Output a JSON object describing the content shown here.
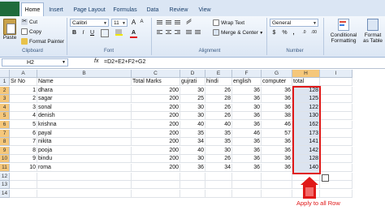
{
  "ribbon": {
    "tabs": [
      "Home",
      "Insert",
      "Page Layout",
      "Formulas",
      "Data",
      "Review",
      "View"
    ],
    "clipboard": {
      "paste": "Paste",
      "cut": "Cut",
      "copy": "Copy",
      "format_painter": "Format Painter",
      "label": "Clipboard"
    },
    "font": {
      "family": "Calibri",
      "size": "11",
      "bold": "B",
      "italic": "I",
      "underline": "U",
      "label": "Font"
    },
    "alignment": {
      "wrap_text": "Wrap Text",
      "merge_center": "Merge & Center",
      "label": "Alignment"
    },
    "number": {
      "format": "General",
      "currency": "$",
      "percent": "%",
      "comma": ",",
      "label": "Number"
    },
    "styles": {
      "conditional_formatting": [
        "Conditional",
        "Formatting"
      ],
      "format_as_table": [
        "Format",
        "as Table"
      ]
    }
  },
  "formula_bar": {
    "name_box": "H2",
    "fx": "fx",
    "formula": "=D2+E2+F2+G2"
  },
  "grid": {
    "columns": [
      "A",
      "B",
      "C",
      "D",
      "E",
      "F",
      "G",
      "H",
      "I"
    ],
    "selected_column": "H",
    "row_numbers": [
      "1",
      "2",
      "3",
      "4",
      "5",
      "6",
      "7",
      "8",
      "9",
      "10",
      "11",
      "12",
      "13",
      "14"
    ],
    "headers": [
      "Sr No",
      "Name",
      "Total Marks",
      "gujrati",
      "hindi",
      "english",
      "computer",
      "total"
    ],
    "rows": [
      [
        "1",
        "dhara",
        "200",
        "30",
        "26",
        "36",
        "36",
        "128"
      ],
      [
        "2",
        "sagar",
        "200",
        "25",
        "28",
        "36",
        "36",
        "125"
      ],
      [
        "3",
        "sonal",
        "200",
        "30",
        "26",
        "30",
        "36",
        "122"
      ],
      [
        "4",
        "denish",
        "200",
        "30",
        "26",
        "36",
        "38",
        "130"
      ],
      [
        "5",
        "krishna",
        "200",
        "40",
        "40",
        "36",
        "46",
        "162"
      ],
      [
        "6",
        "payal",
        "200",
        "35",
        "35",
        "46",
        "57",
        "173"
      ],
      [
        "7",
        "nikita",
        "200",
        "34",
        "35",
        "36",
        "36",
        "141"
      ],
      [
        "8",
        "pooja",
        "200",
        "40",
        "30",
        "36",
        "36",
        "142"
      ],
      [
        "9",
        "bindu",
        "200",
        "30",
        "26",
        "36",
        "36",
        "128"
      ],
      [
        "10",
        "roma",
        "200",
        "36",
        "34",
        "36",
        "36",
        "140"
      ]
    ]
  },
  "annotation": {
    "text": "Apply to all Row",
    "color": "#e01818"
  }
}
